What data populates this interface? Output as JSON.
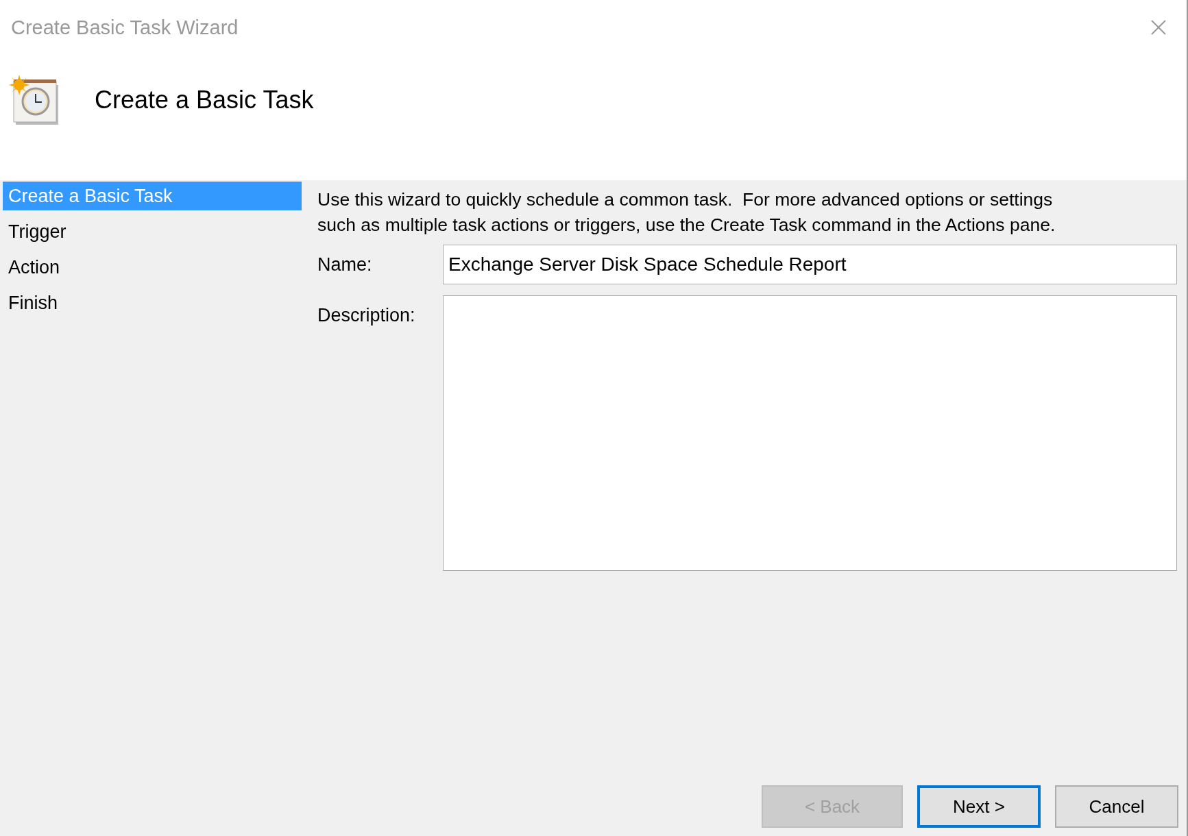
{
  "window": {
    "title": "Create Basic Task Wizard"
  },
  "header": {
    "title": "Create a Basic Task"
  },
  "steps": [
    {
      "label": "Create a Basic Task",
      "selected": true
    },
    {
      "label": "Trigger",
      "selected": false
    },
    {
      "label": "Action",
      "selected": false
    },
    {
      "label": "Finish",
      "selected": false
    }
  ],
  "intro": "Use this wizard to quickly schedule a common task.  For more advanced options or settings such as multiple task actions or triggers, use the Create Task command in the Actions pane.",
  "form": {
    "name": {
      "label": "Name:",
      "value": "Exchange Server Disk Space Schedule Report"
    },
    "description": {
      "label": "Description:"
    }
  },
  "buttons": [
    {
      "label": "< Back",
      "disabled": true,
      "default": false
    },
    {
      "label": "Next >",
      "disabled": false,
      "default": true
    },
    {
      "label": "Cancel",
      "disabled": false,
      "default": false
    }
  ]
}
